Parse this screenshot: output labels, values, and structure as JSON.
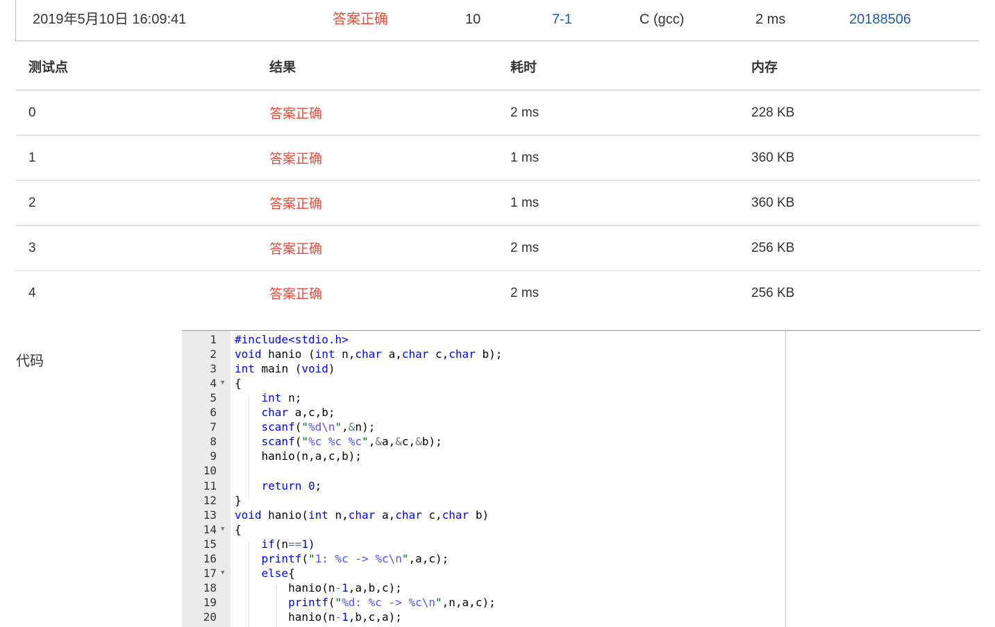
{
  "submission": {
    "time": "2019年5月10日 16:09:41",
    "status": "答案正确",
    "score": "10",
    "problem": "7-1",
    "compiler": "C (gcc)",
    "duration": "2 ms",
    "user": "20188506"
  },
  "cases_table": {
    "headers": [
      "测试点",
      "结果",
      "耗时",
      "内存"
    ],
    "rows": [
      {
        "id": "0",
        "result": "答案正确",
        "time": "2 ms",
        "memory": "228 KB"
      },
      {
        "id": "1",
        "result": "答案正确",
        "time": "1 ms",
        "memory": "360 KB"
      },
      {
        "id": "2",
        "result": "答案正确",
        "time": "1 ms",
        "memory": "360 KB"
      },
      {
        "id": "3",
        "result": "答案正确",
        "time": "2 ms",
        "memory": "256 KB"
      },
      {
        "id": "4",
        "result": "答案正确",
        "time": "2 ms",
        "memory": "256 KB"
      }
    ]
  },
  "code_section": {
    "label": "代码",
    "lines": [
      {
        "n": "1",
        "text": "#include<stdio.h>",
        "fold": false
      },
      {
        "n": "2",
        "text": "void hanio (int n,char a,char c,char b);",
        "fold": false
      },
      {
        "n": "3",
        "text": "int main (void)",
        "fold": false
      },
      {
        "n": "4",
        "text": "{",
        "fold": true
      },
      {
        "n": "5",
        "text": "    int n;",
        "fold": false
      },
      {
        "n": "6",
        "text": "    char a,c,b;",
        "fold": false
      },
      {
        "n": "7",
        "text": "    scanf(\"%d\\n\",&n);",
        "fold": false
      },
      {
        "n": "8",
        "text": "    scanf(\"%c %c %c\",&a,&c,&b);",
        "fold": false
      },
      {
        "n": "9",
        "text": "    hanio(n,a,c,b);",
        "fold": false
      },
      {
        "n": "10",
        "text": "",
        "fold": false
      },
      {
        "n": "11",
        "text": "    return 0;",
        "fold": false
      },
      {
        "n": "12",
        "text": "}",
        "fold": false
      },
      {
        "n": "13",
        "text": "void hanio(int n,char a,char c,char b)",
        "fold": false
      },
      {
        "n": "14",
        "text": "{",
        "fold": true
      },
      {
        "n": "15",
        "text": "    if(n==1)",
        "fold": false
      },
      {
        "n": "16",
        "text": "    printf(\"1: %c -> %c\\n\",a,c);",
        "fold": false
      },
      {
        "n": "17",
        "text": "    else{",
        "fold": true
      },
      {
        "n": "18",
        "text": "        hanio(n-1,a,b,c);",
        "fold": false
      },
      {
        "n": "19",
        "text": "        printf(\"%d: %c -> %c\\n\",n,a,c);",
        "fold": false
      },
      {
        "n": "20",
        "text": "        hanio(n-1,b,c,a);",
        "fold": false
      }
    ]
  }
}
